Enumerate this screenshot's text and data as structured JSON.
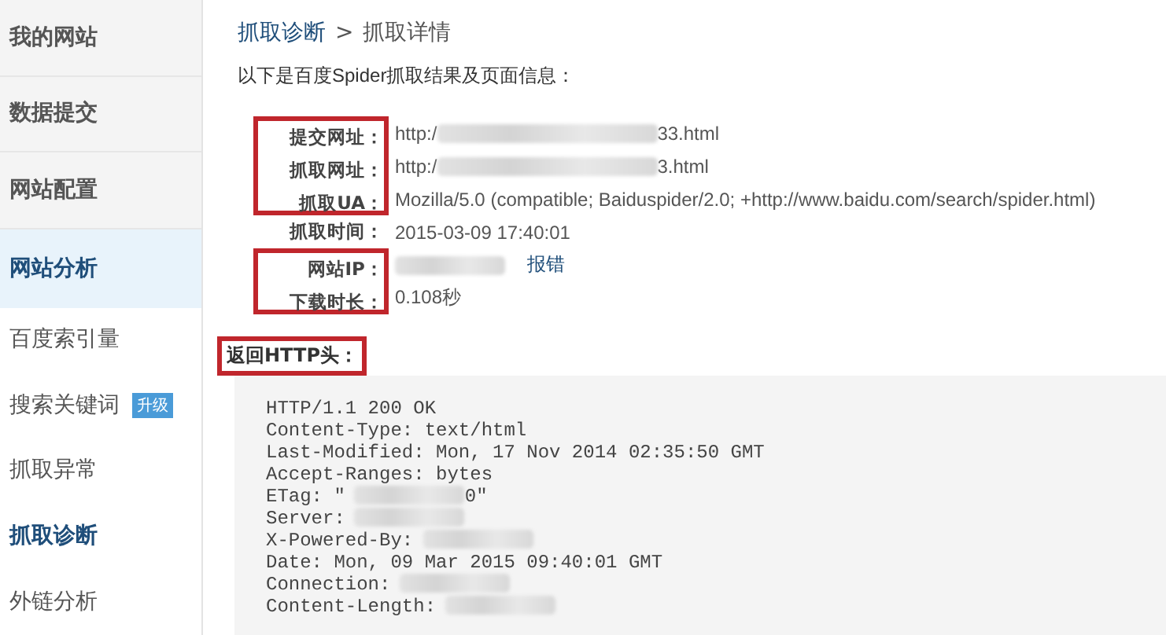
{
  "sidebar": {
    "items": [
      {
        "kind": "section",
        "label": "我的网站",
        "selected": false
      },
      {
        "kind": "section",
        "label": "数据提交",
        "selected": false
      },
      {
        "kind": "section",
        "label": "网站配置",
        "selected": false
      },
      {
        "kind": "section",
        "label": "网站分析",
        "selected": true
      },
      {
        "kind": "subitem",
        "label": "百度索引量",
        "selected": false
      },
      {
        "kind": "subitem",
        "label": "搜索关键词",
        "selected": false,
        "badge": "升级"
      },
      {
        "kind": "subitem",
        "label": "抓取异常",
        "selected": false
      },
      {
        "kind": "subitem",
        "label": "抓取诊断",
        "selected": true
      },
      {
        "kind": "subitem",
        "label": "外链分析",
        "selected": false
      }
    ]
  },
  "breadcrumb": {
    "link": "抓取诊断",
    "separator": ">",
    "current": "抓取详情"
  },
  "intro": "以下是百度Spider抓取结果及页面信息：",
  "info_rows": [
    {
      "label": "提交网址：",
      "highlighted": true,
      "value_start": "http:/",
      "redacted": true,
      "value_end": "33.html"
    },
    {
      "label": "抓取网址：",
      "highlighted": true,
      "value_start": "http:/",
      "redacted": true,
      "value_end": "3.html"
    },
    {
      "label": "抓取UA：",
      "highlighted": true,
      "value_start": "Mozilla/5.0 (compatible; Baiduspider/2.0; +http://www.baidu.com/search/spider.html)",
      "redacted": false
    },
    {
      "label": "抓取时间：",
      "highlighted": false,
      "value_start": "2015-03-09 17:40:01",
      "redacted": false
    },
    {
      "label": "网站IP：",
      "highlighted": true,
      "redacted": true,
      "link": "报错"
    },
    {
      "label": "下载时长：",
      "highlighted": true,
      "value_start": "0.108秒",
      "redacted": false
    }
  ],
  "http_header": {
    "label": "返回HTTP头：",
    "highlighted": true,
    "lines": [
      {
        "text": "HTTP/1.1 200 OK",
        "redacted": false
      },
      {
        "text": "Content-Type: text/html",
        "redacted": false
      },
      {
        "text": "Last-Modified: Mon, 17 Nov 2014 02:35:50 GMT",
        "redacted": false
      },
      {
        "text": "Accept-Ranges: bytes",
        "redacted": false
      },
      {
        "text": "ETag: \"",
        "redacted": true,
        "end": "0\""
      },
      {
        "text": "Server:",
        "redacted": true
      },
      {
        "text": "X-Powered-By:",
        "redacted": true
      },
      {
        "text": "Date: Mon, 09 Mar 2015 09:40:01 GMT",
        "redacted": false
      },
      {
        "text": "Connection:",
        "redacted": true
      },
      {
        "text": "Content-Length:",
        "redacted": true
      }
    ]
  }
}
